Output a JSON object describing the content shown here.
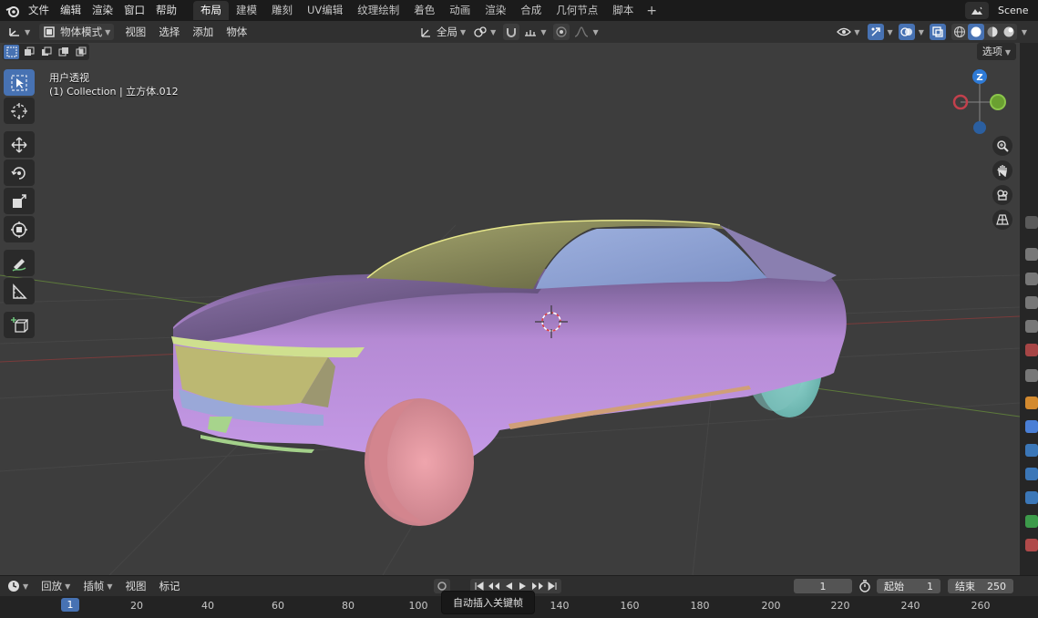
{
  "topbar": {
    "menus": [
      "文件",
      "编辑",
      "渲染",
      "窗口",
      "帮助"
    ],
    "workspaces": [
      "布局",
      "建模",
      "雕刻",
      "UV编辑",
      "纹理绘制",
      "着色",
      "动画",
      "渲染",
      "合成",
      "几何节点",
      "脚本"
    ],
    "active_workspace": "布局",
    "add_label": "+",
    "scene": "Scene"
  },
  "header": {
    "mode": "物体模式",
    "menus": [
      "视图",
      "选择",
      "添加",
      "物体"
    ],
    "transform_orientation": "全局",
    "options": "选项"
  },
  "viewport": {
    "view_name": "用户透视",
    "collection_info": "(1) Collection | 立方体.012",
    "gizmo_axes": {
      "z": "Z"
    }
  },
  "timeline": {
    "menus": [
      "回放",
      "插帧",
      "视图",
      "标记"
    ],
    "current_frame": "1",
    "start_label": "起始",
    "start_value": "1",
    "end_label": "结束",
    "end_value": "250",
    "ruler": [
      "1",
      "20",
      "40",
      "60",
      "80",
      "100",
      "140",
      "160",
      "180",
      "200",
      "220",
      "240",
      "260"
    ],
    "tooltip": "自动插入关键帧"
  },
  "colors": {
    "accent": "#4772b3",
    "body": "#c49ae6",
    "roof": "#c4c46a",
    "window": "#8fa4d6",
    "wheel_front": "#e3959f",
    "wheel_rear": "#86d2cc",
    "lamp": "#d4d48e"
  }
}
